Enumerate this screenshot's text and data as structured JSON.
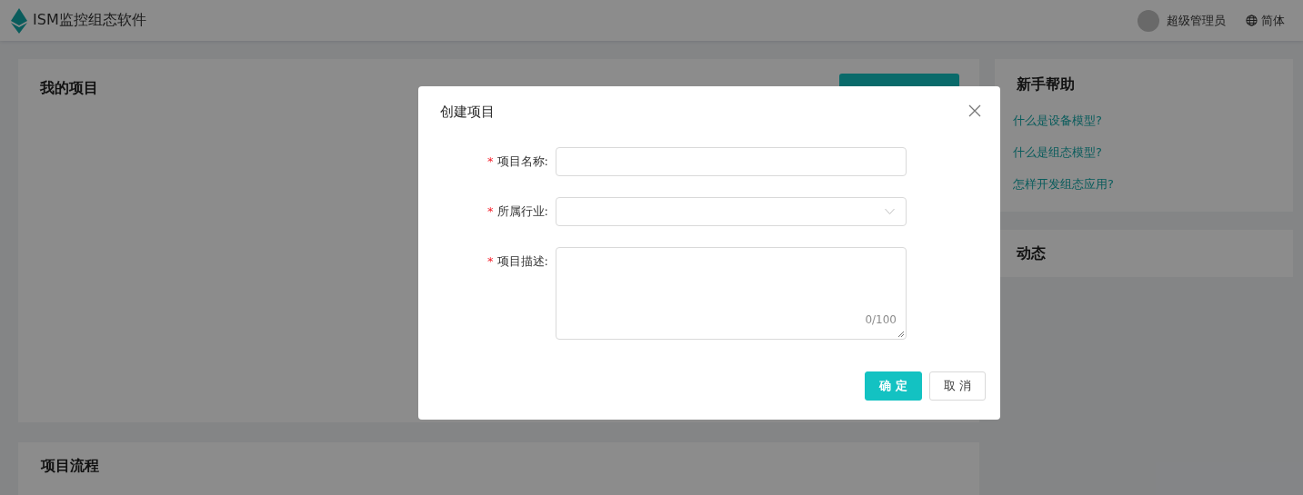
{
  "header": {
    "app_name": "ISM监控组态软件",
    "user_name": "超级管理员",
    "language": "简体"
  },
  "projects_card": {
    "title": "我的项目"
  },
  "flow_card": {
    "title": "项目流程"
  },
  "help_card": {
    "title": "新手帮助",
    "links": [
      "什么是设备模型?",
      "什么是组态模型?",
      "怎样开发组态应用?"
    ]
  },
  "activity_card": {
    "title": "动态"
  },
  "dialog": {
    "title": "创建项目",
    "fields": [
      {
        "kind": "text",
        "label": "项目名称:",
        "required_mark": "*"
      },
      {
        "kind": "select",
        "label": "所属行业:",
        "required_mark": "*"
      },
      {
        "kind": "textarea",
        "label": "项目描述:",
        "required_mark": "*",
        "counter": "0/100"
      }
    ],
    "buttons": [
      {
        "kind": "primary",
        "label": "确 定"
      },
      {
        "kind": "default",
        "label": "取 消"
      }
    ]
  }
}
